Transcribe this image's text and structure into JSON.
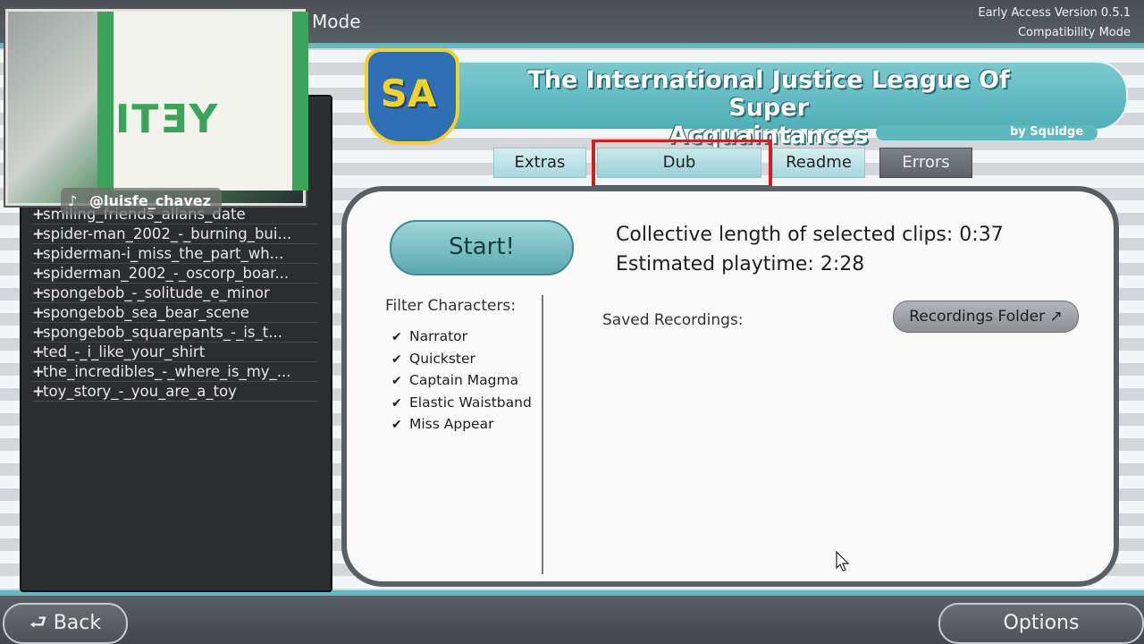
{
  "top": {
    "mode_label": "b Mode",
    "version": "Early Access Version 0.5.1",
    "compat": "Compatibility Mode"
  },
  "overlay": {
    "tiktok_handle": "@luisfe_chavez",
    "shirt_text": "ITƎY"
  },
  "header": {
    "logo_text": "SA",
    "title_line1": "The International Justice League Of Super",
    "title_line2": "Acquaintances",
    "byline": "by Squidge"
  },
  "tabs": [
    {
      "label": "Extras"
    },
    {
      "label": "Dub"
    },
    {
      "label": "Readme"
    },
    {
      "label": "Errors"
    }
  ],
  "clips": [
    "smiling_friends_allans_date",
    "spider-man_2002_-_burning_bui...",
    "spiderman-i_miss_the_part_wh...",
    "spiderman_2002_-_oscorp_boar...",
    "spongebob_-_solitude_e_minor",
    "spongebob_sea_bear_scene",
    "spongebob_squarepants_-_is_t...",
    "ted_-_i_like_your_shirt",
    "the_incredibles_-_where_is_my_...",
    "toy_story_-_you_are_a_toy"
  ],
  "main": {
    "start_label": "Start!",
    "length_label": "Collective length of selected clips:  0:37",
    "playtime_label": "Estimated playtime:  2:28",
    "filter_label": "Filter Characters:",
    "characters": [
      "Narrator",
      "Quickster",
      "Captain Magma",
      "Elastic Waistband",
      "Miss Appear"
    ],
    "saved_label": "Saved Recordings:",
    "rec_folder_label": "Recordings Folder ↗"
  },
  "bottom": {
    "back_label": "Back",
    "options_label": "Options"
  }
}
